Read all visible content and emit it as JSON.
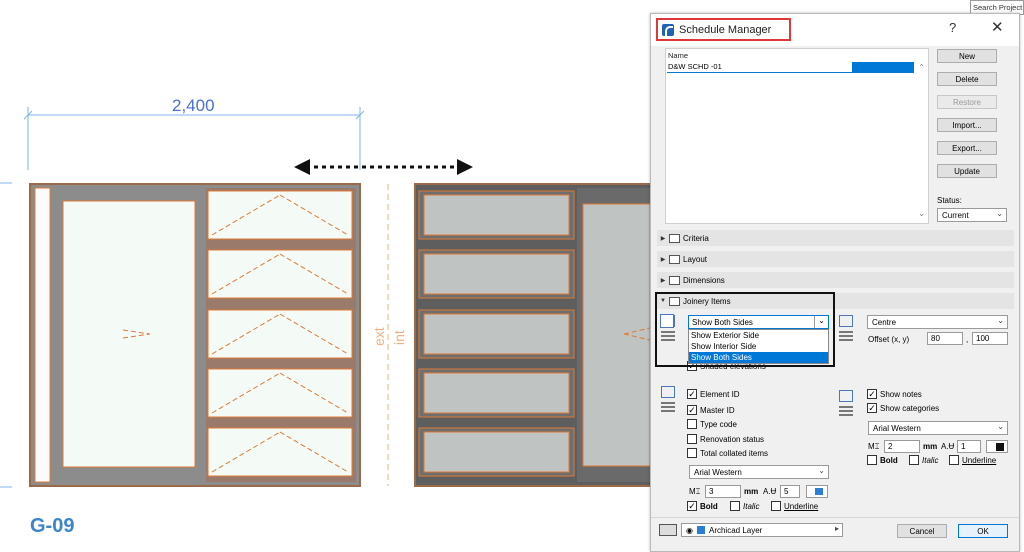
{
  "drawing": {
    "dimension_value": "2,400",
    "label_ext": "ext",
    "label_int": "int",
    "sheet_id": "G-09"
  },
  "search": {
    "placeholder": "Search Project"
  },
  "dialog": {
    "title": "Schedule Manager",
    "help": "?",
    "close": "✕",
    "name_header": "Name",
    "schedules": [
      {
        "name": "D&W SCHD -01",
        "selected": true
      }
    ],
    "buttons": {
      "new": "New",
      "delete": "Delete",
      "restore": "Restore",
      "import": "Import...",
      "export": "Export...",
      "update": "Update"
    },
    "status_label": "Status:",
    "status_value": "Current",
    "sections": {
      "criteria": "Criteria",
      "layout": "Layout",
      "dimensions": "Dimensions",
      "joinery": "Joinery Items"
    },
    "joinery": {
      "sides_selected": "Show Both Sides",
      "sides_options": [
        "Show Exterior Side",
        "Show Interior Side",
        "Show Both Sides"
      ],
      "shaded_elevations": "Shaded elevations",
      "element_id": "Element ID",
      "master_id": "Master ID",
      "type_code": "Type code",
      "renovation_status": "Renovation status",
      "total_collated": "Total collated items",
      "font_left": "Arial Western",
      "size_left": "3",
      "unit_left": "mm",
      "pen_left": "5",
      "bold": "Bold",
      "italic": "Italic",
      "underline": "Underline",
      "align_value": "Centre",
      "offset_label": "Offset (x, y)",
      "offset_x": "80",
      "offset_y": "100",
      "show_notes": "Show notes",
      "show_categories": "Show categories",
      "font_right": "Arial Western",
      "size_right": "2",
      "unit_right": "mm",
      "pen_right": "1"
    },
    "layer": "Archicad Layer",
    "cancel": "Cancel",
    "ok": "OK"
  },
  "colors": {
    "accent": "#0078d7",
    "highlight_red": "#e0383a",
    "frame_orange": "#e07a36",
    "glass_light": "#f4faf6",
    "frame_grey": "#8c8c8c",
    "dimension_blue": "#4a6fd0"
  }
}
